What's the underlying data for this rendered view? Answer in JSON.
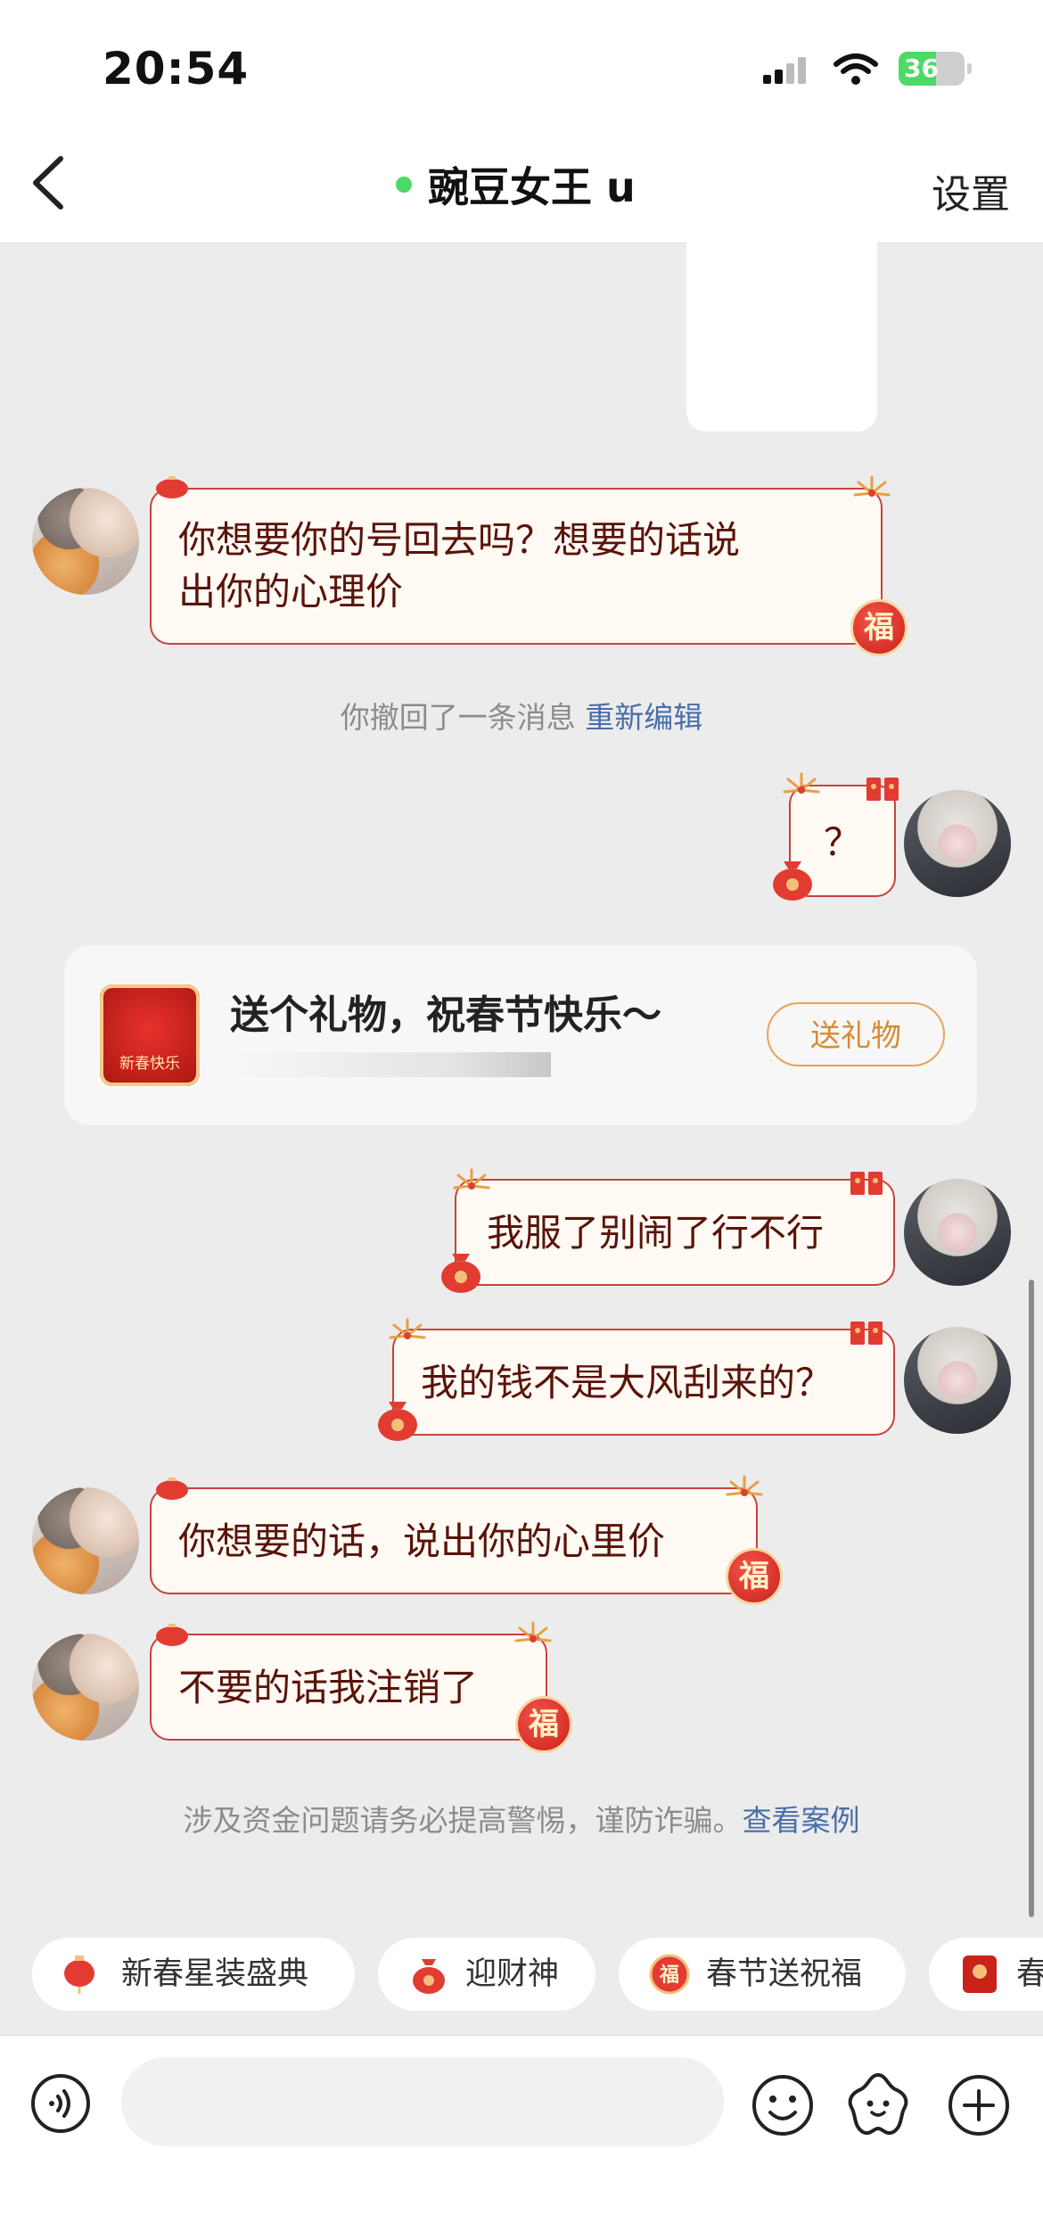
{
  "status_bar": {
    "time": "20:54",
    "battery": "36"
  },
  "header": {
    "title": "豌豆女王 u",
    "settings": "设置"
  },
  "messages": [
    {
      "side": "left",
      "text1": "你想要你的号回去吗？想要的话说",
      "text2": "出你的心理价"
    },
    {
      "side": "right",
      "text": "？"
    },
    {
      "side": "right",
      "text": "我服了别闹了行不行"
    },
    {
      "side": "right",
      "text": "我的钱不是大风刮来的？"
    },
    {
      "side": "left",
      "text": "你想要的话，说出你的心里价"
    },
    {
      "side": "left",
      "text": "不要的话我注销了"
    }
  ],
  "system": {
    "recall_text": "你撤回了一条消息",
    "recall_link": "重新编辑",
    "fraud_text": "涉及资金问题请务必提高警惕，谨防诈骗。",
    "fraud_link": "查看案例"
  },
  "gift_card": {
    "text": "送个礼物，祝春节快乐～",
    "button": "送礼物",
    "image_caption": "新春快乐"
  },
  "badge_char": "福",
  "quick_chips": [
    "新春星装盛典",
    "迎财神",
    "春节送祝福",
    "春"
  ],
  "colors": {
    "accent_green": "#4cd964",
    "bubble_border": "#c7433c",
    "bubble_text": "#5a1308",
    "link": "#4a6ea8",
    "gift_button": "#d98a32"
  }
}
